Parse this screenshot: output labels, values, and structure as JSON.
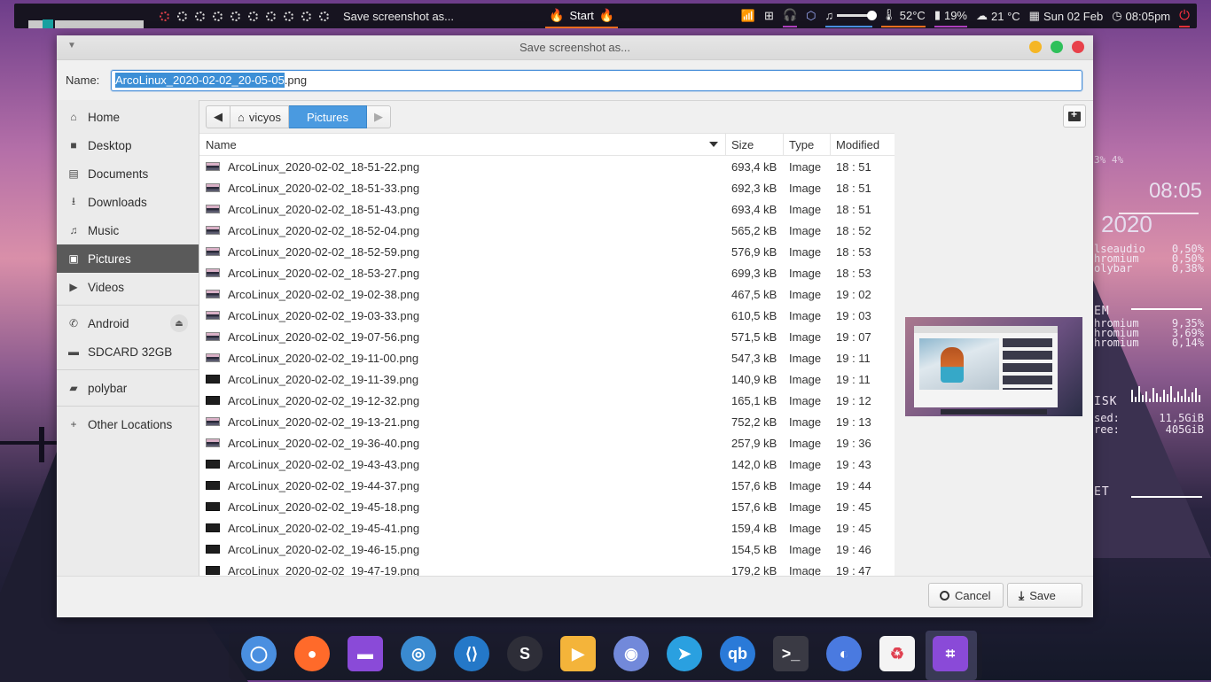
{
  "topbar": {
    "title": "Save screenshot as...",
    "start_label": "Start",
    "temperature": "52°C",
    "battery": "19%",
    "weather": "21 °C",
    "date": "Sun 02 Feb",
    "time": "08:05pm",
    "icons": [
      "wifi-icon",
      "windows-icon",
      "headset-icon",
      "cube-icon",
      "music-icon",
      "volume-slider",
      "thermometer-icon",
      "battery-icon",
      "cloud-icon",
      "calendar-icon",
      "clock-icon",
      "power-icon"
    ]
  },
  "conky": {
    "cpu": "3% 4%",
    "time": "08:05",
    "year": "2020",
    "procs": [
      {
        "name": "lseaudio",
        "pct": "0,50%"
      },
      {
        "name": "hromium",
        "pct": "0,50%"
      },
      {
        "name": "olybar",
        "pct": "0,38%"
      }
    ],
    "mem_head": "EM",
    "mem_procs": [
      {
        "name": "hromium",
        "pct": "9,35%"
      },
      {
        "name": "hromium",
        "pct": "3,69%"
      },
      {
        "name": "hromium",
        "pct": "0,14%"
      }
    ],
    "disk_head": "ISK",
    "disk_used_label": "sed:",
    "disk_used": "11,5GiB",
    "disk_free_label": "ree:",
    "disk_free": "405GiB",
    "net_head": "ET"
  },
  "dialog": {
    "title": "Save screenshot as...",
    "name_label": "Name:",
    "filename_selected": "ArcoLinux_2020-02-02_20-05-05",
    "filename_ext": ".png"
  },
  "sidebar": {
    "places": [
      {
        "label": "Home",
        "icon": "home-icon"
      },
      {
        "label": "Desktop",
        "icon": "desktop-icon"
      },
      {
        "label": "Documents",
        "icon": "documents-icon"
      },
      {
        "label": "Downloads",
        "icon": "downloads-icon"
      },
      {
        "label": "Music",
        "icon": "music-icon"
      },
      {
        "label": "Pictures",
        "icon": "pictures-icon",
        "active": true
      },
      {
        "label": "Videos",
        "icon": "videos-icon"
      }
    ],
    "devices": [
      {
        "label": "Android",
        "icon": "phone-icon",
        "eject": true
      },
      {
        "label": "SDCARD 32GB",
        "icon": "drive-icon"
      }
    ],
    "bookmarks": [
      {
        "label": "polybar",
        "icon": "folder-icon"
      }
    ],
    "other": {
      "label": "Other Locations",
      "icon": "plus-icon"
    }
  },
  "pathbar": {
    "home_label": "vicyos",
    "current_label": "Pictures"
  },
  "columns": {
    "name": "Name",
    "size": "Size",
    "type": "Type",
    "modified": "Modified"
  },
  "files": [
    {
      "name": "ArcoLinux_2020-02-02_18-51-22.png",
      "size": "693,4 kB",
      "type": "Image",
      "modified": "18 : 51",
      "thumb": "light"
    },
    {
      "name": "ArcoLinux_2020-02-02_18-51-33.png",
      "size": "692,3 kB",
      "type": "Image",
      "modified": "18 : 51",
      "thumb": "light"
    },
    {
      "name": "ArcoLinux_2020-02-02_18-51-43.png",
      "size": "693,4 kB",
      "type": "Image",
      "modified": "18 : 51",
      "thumb": "light"
    },
    {
      "name": "ArcoLinux_2020-02-02_18-52-04.png",
      "size": "565,2 kB",
      "type": "Image",
      "modified": "18 : 52",
      "thumb": "light"
    },
    {
      "name": "ArcoLinux_2020-02-02_18-52-59.png",
      "size": "576,9 kB",
      "type": "Image",
      "modified": "18 : 53",
      "thumb": "light"
    },
    {
      "name": "ArcoLinux_2020-02-02_18-53-27.png",
      "size": "699,3 kB",
      "type": "Image",
      "modified": "18 : 53",
      "thumb": "light"
    },
    {
      "name": "ArcoLinux_2020-02-02_19-02-38.png",
      "size": "467,5 kB",
      "type": "Image",
      "modified": "19 : 02",
      "thumb": "light"
    },
    {
      "name": "ArcoLinux_2020-02-02_19-03-33.png",
      "size": "610,5 kB",
      "type": "Image",
      "modified": "19 : 03",
      "thumb": "light"
    },
    {
      "name": "ArcoLinux_2020-02-02_19-07-56.png",
      "size": "571,5 kB",
      "type": "Image",
      "modified": "19 : 07",
      "thumb": "light"
    },
    {
      "name": "ArcoLinux_2020-02-02_19-11-00.png",
      "size": "547,3 kB",
      "type": "Image",
      "modified": "19 : 11",
      "thumb": "light"
    },
    {
      "name": "ArcoLinux_2020-02-02_19-11-39.png",
      "size": "140,9 kB",
      "type": "Image",
      "modified": "19 : 11",
      "thumb": "dark"
    },
    {
      "name": "ArcoLinux_2020-02-02_19-12-32.png",
      "size": "165,1 kB",
      "type": "Image",
      "modified": "19 : 12",
      "thumb": "dark"
    },
    {
      "name": "ArcoLinux_2020-02-02_19-13-21.png",
      "size": "752,2 kB",
      "type": "Image",
      "modified": "19 : 13",
      "thumb": "light"
    },
    {
      "name": "ArcoLinux_2020-02-02_19-36-40.png",
      "size": "257,9 kB",
      "type": "Image",
      "modified": "19 : 36",
      "thumb": "light"
    },
    {
      "name": "ArcoLinux_2020-02-02_19-43-43.png",
      "size": "142,0 kB",
      "type": "Image",
      "modified": "19 : 43",
      "thumb": "dark"
    },
    {
      "name": "ArcoLinux_2020-02-02_19-44-37.png",
      "size": "157,6 kB",
      "type": "Image",
      "modified": "19 : 44",
      "thumb": "dark"
    },
    {
      "name": "ArcoLinux_2020-02-02_19-45-18.png",
      "size": "157,6 kB",
      "type": "Image",
      "modified": "19 : 45",
      "thumb": "dark"
    },
    {
      "name": "ArcoLinux_2020-02-02_19-45-41.png",
      "size": "159,4 kB",
      "type": "Image",
      "modified": "19 : 45",
      "thumb": "dark"
    },
    {
      "name": "ArcoLinux_2020-02-02_19-46-15.png",
      "size": "154,5 kB",
      "type": "Image",
      "modified": "19 : 46",
      "thumb": "dark"
    },
    {
      "name": "ArcoLinux_2020-02-02_19-47-19.png",
      "size": "179,2 kB",
      "type": "Image",
      "modified": "19 : 47",
      "thumb": "dark"
    }
  ],
  "buttons": {
    "cancel": "Cancel",
    "save": "Save"
  },
  "dock": [
    {
      "name": "chromium-dock-icon",
      "color": "#4a8fe0",
      "glyph": "◯"
    },
    {
      "name": "firefox-dock-icon",
      "color": "#ff6a2a",
      "glyph": "●"
    },
    {
      "name": "files-dock-icon",
      "color": "#8a4ad8",
      "glyph": "▬"
    },
    {
      "name": "browser-dock-icon",
      "color": "#3a8ad0",
      "glyph": "◎"
    },
    {
      "name": "vscode-dock-icon",
      "color": "#2478c8",
      "glyph": "⟨⟩"
    },
    {
      "name": "skype-dock-icon",
      "color": "#2e2e38",
      "glyph": "S"
    },
    {
      "name": "media-player-dock-icon",
      "color": "#f4b43a",
      "glyph": "▶"
    },
    {
      "name": "discord-dock-icon",
      "color": "#7289da",
      "glyph": "◉"
    },
    {
      "name": "telegram-dock-icon",
      "color": "#2aa0e0",
      "glyph": "➤"
    },
    {
      "name": "qbittorrent-dock-icon",
      "color": "#2a7ad8",
      "glyph": "qb"
    },
    {
      "name": "terminal-dock-icon",
      "color": "#3a3a44",
      "glyph": ">_"
    },
    {
      "name": "toggle-dock-icon",
      "color": "#4a7ae0",
      "glyph": "◐"
    },
    {
      "name": "trash-dock-icon",
      "color": "#f4f4f4",
      "glyph": "♻"
    },
    {
      "name": "screenshot-dock-icon",
      "color": "#8a4ad8",
      "glyph": "⌗"
    }
  ]
}
